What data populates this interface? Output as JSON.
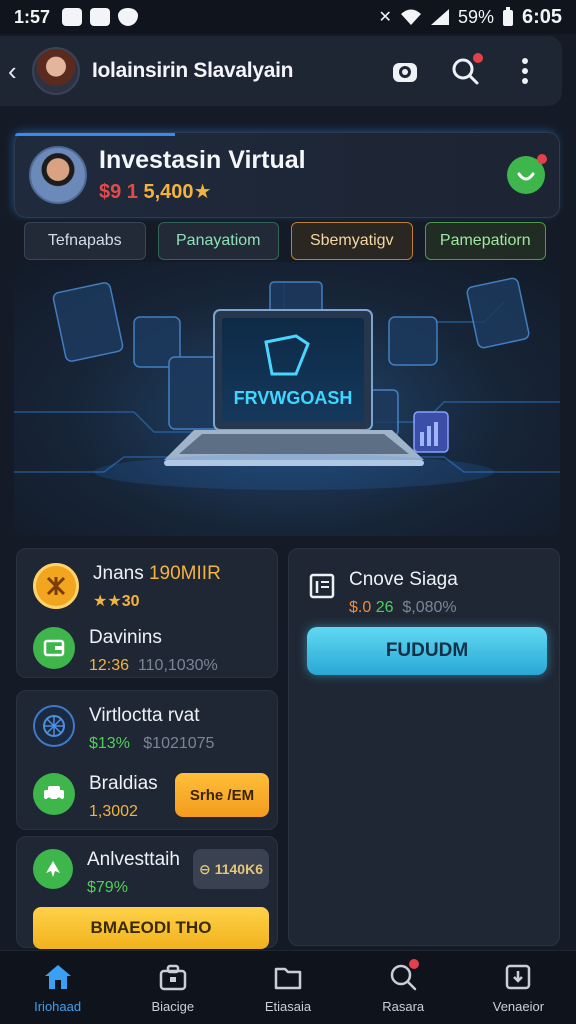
{
  "status_bar": {
    "time": "1:57",
    "battery": "59%",
    "clock": "6:05"
  },
  "app_bar": {
    "title": "Iolainsirin Slavalyain",
    "icons": [
      "chevron-left-icon",
      "camera-icon",
      "search-icon",
      "more-vertical-icon"
    ]
  },
  "profile": {
    "title": "Investasin Virtual",
    "balance_prefix": "$9 1",
    "balance_value": "5,400",
    "balance_star": "★",
    "badge_icon": "smile-badge-icon"
  },
  "tabs": [
    {
      "label": "Tefnapabs"
    },
    {
      "label": "Panayatiom"
    },
    {
      "label": "Sbemyatigv"
    },
    {
      "label": "Pamepatiorn"
    }
  ],
  "hero": {
    "screen_text": "FRVWGOASH"
  },
  "left_cards": {
    "jnans": {
      "title_a": "Jnans ",
      "title_b": "190MIIR",
      "sub": "★★30"
    },
    "davinins": {
      "title": "Davinins",
      "sub_a": "12:36",
      "sub_b": "110,1030%"
    },
    "virtual": {
      "title": "Virtloctta rvat",
      "sub_a": "$13%",
      "sub_b": "$1021075"
    },
    "braldias": {
      "title": "Braldias",
      "sub": "1,3002",
      "button": "Srhe /EM"
    },
    "investtaih": {
      "title": "Anlvesttaih",
      "sub": "$79%",
      "chip": "1140K6",
      "button": "BMAEODI THO"
    }
  },
  "choose_card": {
    "title": "Cnove Siaga",
    "sub_a": "$.0",
    "sub_b": "26",
    "sub_c": "$,080%",
    "button": "FUDUDM"
  },
  "nav": [
    {
      "label": "Iriohaad",
      "icon": "home-icon",
      "active": true
    },
    {
      "label": "Biacige",
      "icon": "briefcase-icon",
      "active": false
    },
    {
      "label": "Etiasaia",
      "icon": "folder-icon",
      "active": false
    },
    {
      "label": "Rasara",
      "icon": "search-badge-icon",
      "active": false
    },
    {
      "label": "Venaeior",
      "icon": "download-box-icon",
      "active": false
    }
  ],
  "colors": {
    "accent_blue": "#2f8cff",
    "gold": "#f3b33d",
    "green": "#4fcf5a",
    "button_cyan": "#3fc3e6"
  }
}
